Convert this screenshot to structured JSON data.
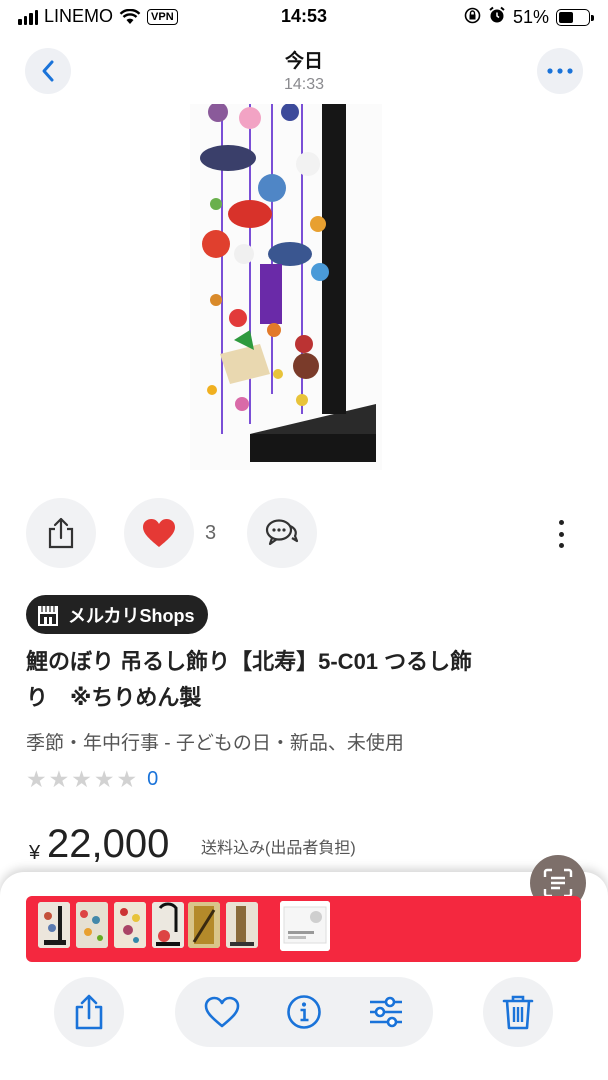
{
  "status_bar": {
    "carrier": "LINEMO",
    "vpn": "VPN",
    "time": "14:53",
    "battery_percent": "51%",
    "battery_level": 0.51
  },
  "header": {
    "title": "今日",
    "subtitle": "14:33"
  },
  "actions": {
    "like_count": "3"
  },
  "shop_badge": {
    "label": "メルカリShops"
  },
  "product": {
    "title_line1": "鯉のぼり 吊るし飾り【北寿】5-C01 つるし飾",
    "title_line2": "り　※ちりめん製",
    "category": "季節・年中行事 - 子どもの日・新品、未使用",
    "rating_stars": 0,
    "rating_max": 5,
    "rating_count": "0",
    "price_currency": "¥",
    "price": "22,000",
    "shipping_note": "送料込み(出品者負担)"
  },
  "colors": {
    "accent_red": "#f4283f",
    "heart_red": "#e53935",
    "icon_blue": "#1a73d9",
    "link_blue": "#1a73d9"
  },
  "toolbar": {
    "icons": [
      "share-icon",
      "heart-outline-icon",
      "info-icon",
      "sliders-icon",
      "trash-icon"
    ]
  }
}
